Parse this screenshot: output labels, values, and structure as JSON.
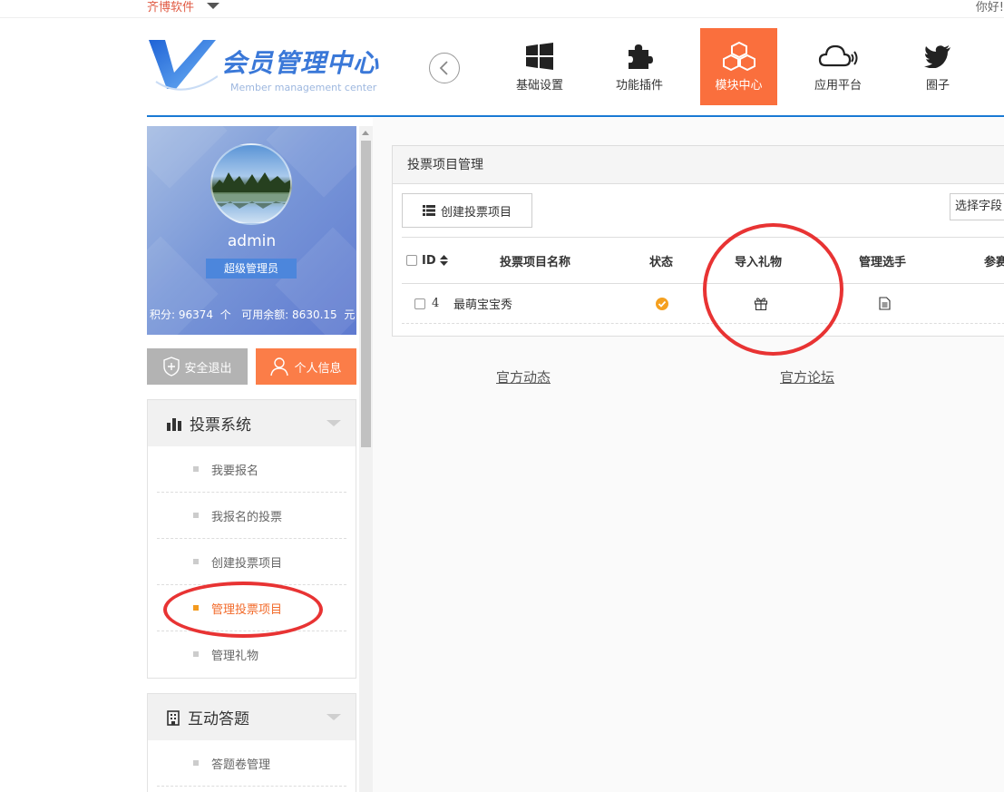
{
  "topbar": {
    "brand": "齐博软件",
    "greeting": "你好!"
  },
  "logo": {
    "title": "会员管理中心",
    "subtitle": "Member management center"
  },
  "nav": [
    {
      "label": "基础设置",
      "icon": "windows-icon"
    },
    {
      "label": "功能插件",
      "icon": "puzzle-icon"
    },
    {
      "label": "模块中心",
      "icon": "cubes-icon",
      "active": true
    },
    {
      "label": "应用平台",
      "icon": "cloud-icon"
    },
    {
      "label": "圈子",
      "icon": "twitter-bird-icon"
    }
  ],
  "profile": {
    "username": "admin",
    "role": "超级管理员",
    "points_label": "积分:",
    "points": "96374",
    "points_unit": "个",
    "balance_label": "可用余额:",
    "balance": "8630.15",
    "balance_unit": "元"
  },
  "buttons": {
    "logout": "安全退出",
    "info": "个人信息"
  },
  "sidebar": {
    "vote": {
      "title": "投票系统",
      "items": [
        "我要报名",
        "我报名的投票",
        "创建投票项目",
        "管理投票项目",
        "管理礼物"
      ]
    },
    "qa": {
      "title": "互动答题",
      "items": [
        "答题卷管理"
      ]
    }
  },
  "card": {
    "title": "投票项目管理",
    "create_button": "创建投票项目",
    "field_select": "选择字段",
    "columns": [
      "ID",
      "投票项目名称",
      "状态",
      "导入礼物",
      "管理选手",
      "参赛"
    ],
    "rows": [
      {
        "id": "4",
        "name": "最萌宝宝秀",
        "status": "check",
        "gift": "gift-icon",
        "manage": "document-icon"
      }
    ]
  },
  "footer_links": [
    "官方动态",
    "官方论坛"
  ],
  "colors": {
    "accent": "#fa6f3d",
    "primary": "#1a7ad4",
    "annotation": "#e83333"
  }
}
